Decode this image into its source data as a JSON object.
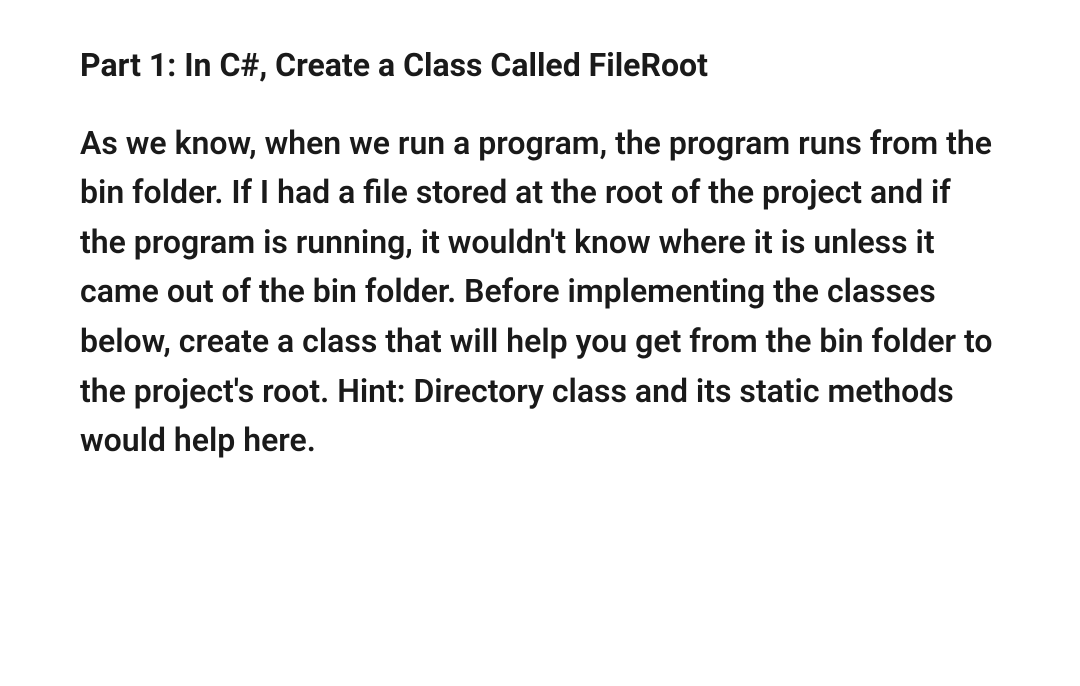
{
  "title": "Part 1: In C#, Create a Class Called FileRoot",
  "body": "As we know, when we run a program, the program runs from the bin folder. If I had a file stored at the root of the project and if the program is running, it wouldn't know where it is unless it came out of the bin folder. Before implementing the classes below, create a class that will help you get from the bin folder to the project's root. Hint: Directory class and its static methods would help here."
}
